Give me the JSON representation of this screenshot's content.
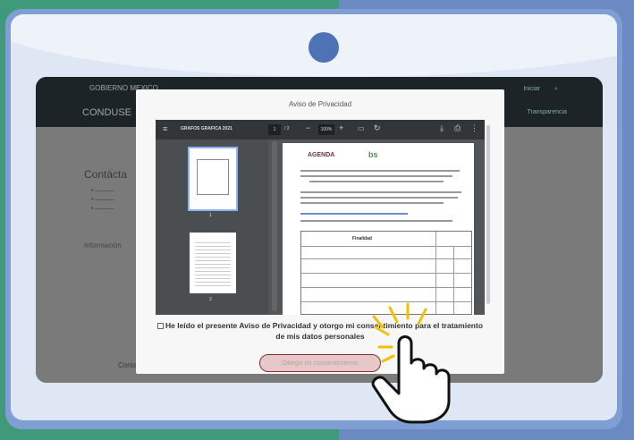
{
  "modal": {
    "title": "Aviso de Privacidad",
    "viewer": {
      "menu_icon": "menu-icon",
      "file_name": "GRAFOS GRAFICA 2021",
      "page_current": "1",
      "page_total": "/ 2",
      "zoom": "100%",
      "thumbnail_pages": [
        "1",
        "2"
      ]
    },
    "document": {
      "logo_text": "AGENDA",
      "logo_text_2": "bs",
      "table_heading": "Finalidad"
    },
    "consent_text": "He leído el presente Aviso de Privacidad y otorgo mi consentimiento para el tratamiento de mis datos personales",
    "button_label": "Otorgo mi consentimiento"
  },
  "background_site": {
    "brand": "CONDUSE",
    "logo_text": "GOBIERNO MEXICO",
    "nav_links": [
      "Iniciar",
      "Búsqueda"
    ],
    "nav_right": "Transparencia",
    "heading": "Contácta",
    "info_label": "Información",
    "bottom_label": "Contactanos"
  },
  "colors": {
    "brand_button_border": "#8c2a3c",
    "device_frame": "#7f9fd4",
    "camera": "#4d73b6"
  }
}
